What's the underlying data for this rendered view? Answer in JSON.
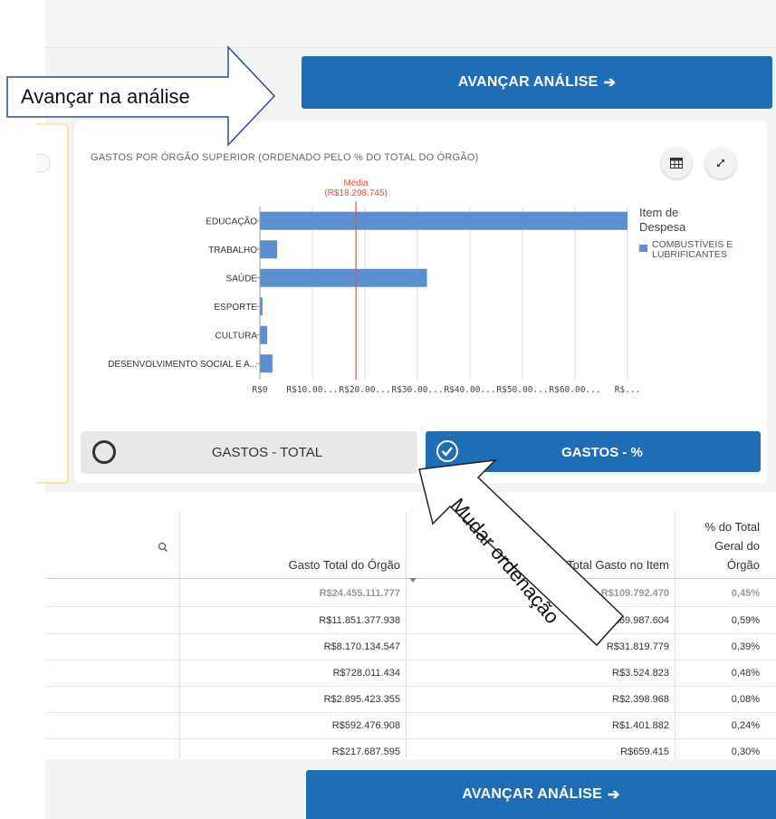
{
  "annotation": {
    "advance_callout": "Avançar na análise",
    "change_order_callout": "Mudar ordenação"
  },
  "advance_button_label": "AVANÇAR ANÁLISE",
  "chart_panel": {
    "title": "GASTOS POR ÓRGÃO SUPERIOR (ORDENADO PELO % DO TOTAL DO ÓRGÃO)",
    "table_icon": "table-icon",
    "expand_icon": "expand-icon",
    "mean_label": "Média",
    "mean_value_label": "(R$18.298.745)",
    "legend_title_line1": "Item de",
    "legend_title_line2": "Despesa",
    "legend_item_line1": "COMBUSTÍVEIS E",
    "legend_item_line2": "LUBRIFICANTES",
    "bar_color": "#5b8fcf",
    "mean_color": "#e8523a"
  },
  "chart_data": {
    "type": "bar",
    "orientation": "horizontal",
    "title": "GASTOS POR ÓRGÃO SUPERIOR (ORDENADO PELO % DO TOTAL DO ÓRGÃO)",
    "categories": [
      "EDUCAÇÃO",
      "TRABALHO",
      "SAÚDE",
      "ESPORTE",
      "CULTURA",
      "DESENVOLVIMENTO SOCIAL E A..."
    ],
    "series": [
      {
        "name": "COMBUSTÍVEIS E LUBRIFICANTES",
        "values": [
          69987604,
          3300000,
          31819779,
          500000,
          1400000,
          2398968
        ]
      }
    ],
    "x_ticks": [
      "R$0",
      "R$10.00...",
      "R$20.00...",
      "R$30.00...",
      "R$40.00...",
      "R$50.00...",
      "R$60.00...",
      "R$..."
    ],
    "xlim": [
      0,
      70000000
    ],
    "mean": 18298745,
    "legend": "right",
    "grid": true
  },
  "toggles": {
    "total_label": "GASTOS - TOTAL",
    "percent_label": "GASTOS - %",
    "selected": "GASTOS - %"
  },
  "table": {
    "search_icon": "search-icon",
    "headers": {
      "gasto_total": "Gasto Total do Órgão",
      "total_item": "Total Gasto no Item",
      "pct_line1": "% do Total",
      "pct_line2": "Geral do",
      "pct_line3": "Órgão"
    },
    "total_row": {
      "gasto_total": "R$24.455.111.777",
      "total_item": "R$109.792.470",
      "pct": "0,45%"
    },
    "rows": [
      {
        "gasto_total": "R$11.851.377.938",
        "total_item": "R$69.987.604",
        "pct": "0,59%"
      },
      {
        "gasto_total": "R$8.170.134.547",
        "total_item": "R$31.819.779",
        "pct": "0,39%"
      },
      {
        "gasto_total": "R$728.011.434",
        "total_item": "R$3.524.823",
        "pct": "0,48%"
      },
      {
        "gasto_total": "R$2.895.423.355",
        "total_item": "R$2.398.968",
        "pct": "0,08%"
      },
      {
        "gasto_total": "R$592.476.908",
        "total_item": "R$1.401.882",
        "pct": "0,24%"
      },
      {
        "gasto_total": "R$217.687.595",
        "total_item": "R$659.415",
        "pct": "0,30%"
      }
    ]
  }
}
